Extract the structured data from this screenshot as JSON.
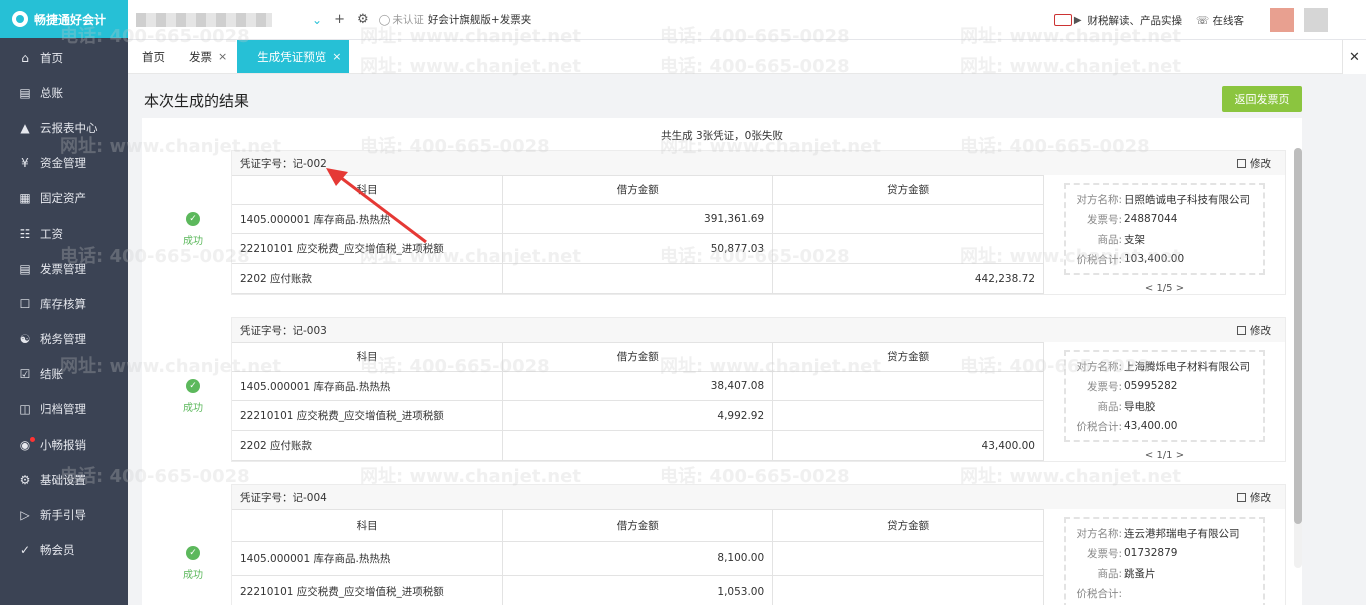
{
  "app": {
    "logo_text": "畅捷通好会计"
  },
  "sidebar": {
    "items": [
      {
        "label": "首页",
        "icon": "home-icon"
      },
      {
        "label": "总账",
        "icon": "ledger-icon"
      },
      {
        "label": "云报表中心",
        "icon": "chart-icon"
      },
      {
        "label": "资金管理",
        "icon": "money-icon"
      },
      {
        "label": "固定资产",
        "icon": "building-icon"
      },
      {
        "label": "工资",
        "icon": "salary-icon"
      },
      {
        "label": "发票管理",
        "icon": "invoice-icon"
      },
      {
        "label": "库存核算",
        "icon": "warehouse-icon"
      },
      {
        "label": "税务管理",
        "icon": "tax-icon"
      },
      {
        "label": "结账",
        "icon": "close-books-icon"
      },
      {
        "label": "归档管理",
        "icon": "archive-icon"
      },
      {
        "label": "小畅报销",
        "icon": "reimburse-icon"
      },
      {
        "label": "基础设置",
        "icon": "gear-icon"
      },
      {
        "label": "新手引导",
        "icon": "guide-icon"
      },
      {
        "label": "畅会员",
        "icon": "vip-icon"
      }
    ]
  },
  "topbar": {
    "cert_label": "未认证",
    "version_label": "好会计旗舰版+发票夹",
    "news_label": "财税解读、产品实操",
    "online_label": "在线客"
  },
  "tabs": [
    {
      "label": "首页",
      "closable": false
    },
    {
      "label": "发票",
      "closable": true
    },
    {
      "label": "生成凭证预览",
      "closable": true,
      "active": true
    }
  ],
  "main": {
    "title": "本次生成的结果",
    "back_button": "返回发票页",
    "summary": "共生成 3张凭证，0张失败",
    "edit_label": "修改",
    "status_label": "成功",
    "columns": [
      "科目",
      "借方金额",
      "贷方金额"
    ],
    "invoice_keys": {
      "party": "对方名称:",
      "no": "发票号:",
      "goods": "商品:",
      "total": "价税合计:"
    }
  },
  "vouchers": [
    {
      "number": "凭证字号：记-002",
      "rows": [
        {
          "account": "1405.000001 库存商品.热热热",
          "debit": "391,361.69",
          "credit": ""
        },
        {
          "account": "22210101 应交税费_应交增值税_进项税额",
          "debit": "50,877.03",
          "credit": ""
        },
        {
          "account": "2202 应付账款",
          "debit": "",
          "credit": "442,238.72"
        }
      ],
      "invoice": {
        "party": "日照皓诚电子科技有限公司",
        "no": "24887044",
        "goods": "支架",
        "total": "103,400.00"
      },
      "pager": "< 1/5 >"
    },
    {
      "number": "凭证字号：记-003",
      "rows": [
        {
          "account": "1405.000001 库存商品.热热热",
          "debit": "38,407.08",
          "credit": ""
        },
        {
          "account": "22210101 应交税费_应交增值税_进项税额",
          "debit": "4,992.92",
          "credit": ""
        },
        {
          "account": "2202 应付账款",
          "debit": "",
          "credit": "43,400.00"
        }
      ],
      "invoice": {
        "party": "上海腾烁电子材料有限公司",
        "no": "05995282",
        "goods": "导电胶",
        "total": "43,400.00"
      },
      "pager": "< 1/1 >"
    },
    {
      "number": "凭证字号：记-004",
      "rows": [
        {
          "account": "1405.000001 库存商品.热热热",
          "debit": "8,100.00",
          "credit": ""
        },
        {
          "account": "22210101 应交税费_应交增值税_进项税额",
          "debit": "1,053.00",
          "credit": ""
        }
      ],
      "invoice": {
        "party": "连云港邦瑞电子有限公司",
        "no": "01732879",
        "goods": "跳蚤片",
        "total": ""
      },
      "pager": ""
    }
  ],
  "watermark": {
    "phone": "电话: 400-665-0028",
    "site": "网址: www.chanjet.net"
  },
  "colors": {
    "accent": "#26c0d6",
    "sidebar": "#3b4354",
    "success": "#5cb85c",
    "back_button": "#8bc53f",
    "annotation": "#e53935"
  }
}
